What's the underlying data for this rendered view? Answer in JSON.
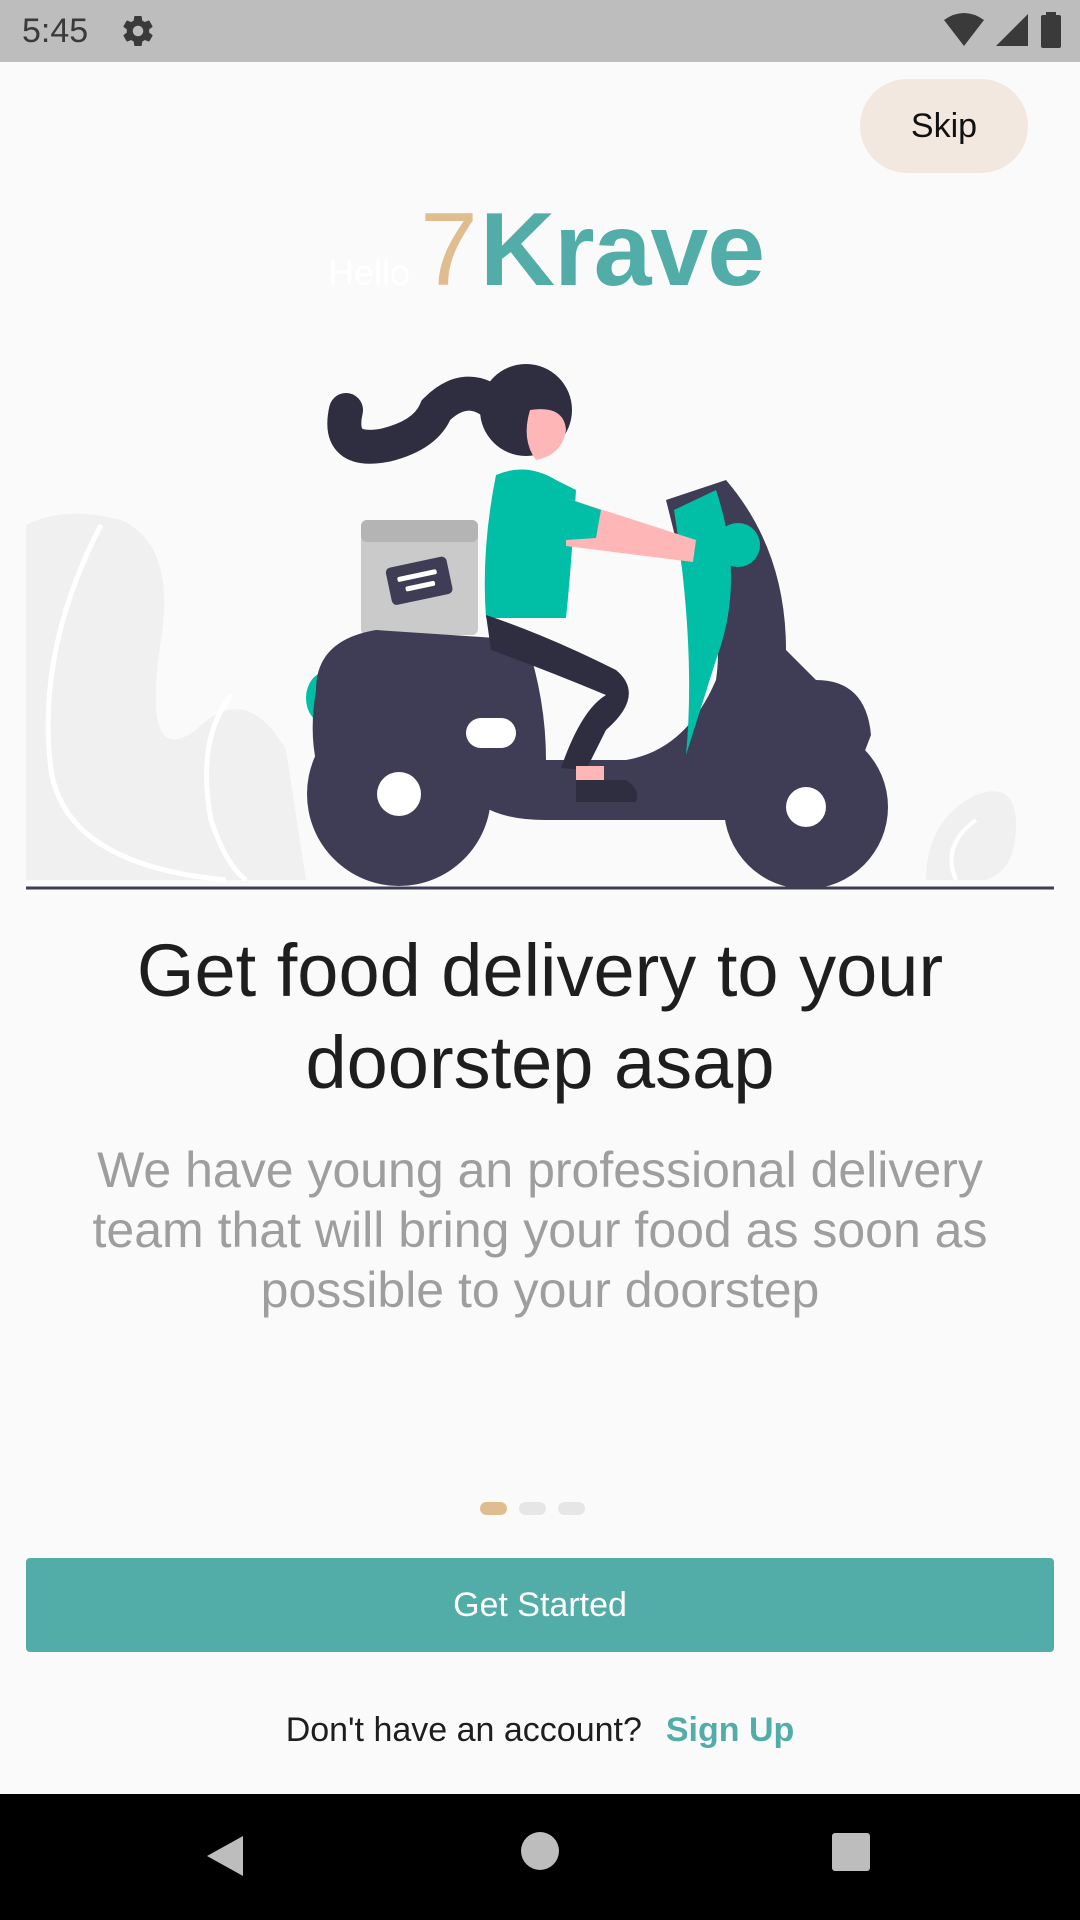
{
  "status_bar": {
    "time": "5:45",
    "icons": [
      "gear-icon",
      "wifi-icon",
      "signal-icon",
      "battery-icon"
    ]
  },
  "onboarding": {
    "skip_label": "Skip",
    "logo": {
      "hello": "Hello",
      "seven": "7",
      "name": "Krave"
    },
    "illustration": "woman-riding-scooter-delivery",
    "title": "Get food delivery to your doorstep asap",
    "subtitle": "We have young an professional delivery team that will bring your food as soon as possible to your doorstep",
    "pager": {
      "total": 3,
      "active_index": 0
    }
  },
  "actions": {
    "get_started_label": "Get Started",
    "signup_prompt": "Don't have an account?",
    "signup_link": "Sign Up"
  },
  "colors": {
    "primary": "#52aca8",
    "accent": "#e0bd8f",
    "skip_bg": "#f3e8e0",
    "illustration_teal": "#00bfa6",
    "illustration_dark": "#3f3d56"
  },
  "nav_bar": {
    "icons": [
      "back-icon",
      "home-icon",
      "recent-apps-icon"
    ]
  }
}
